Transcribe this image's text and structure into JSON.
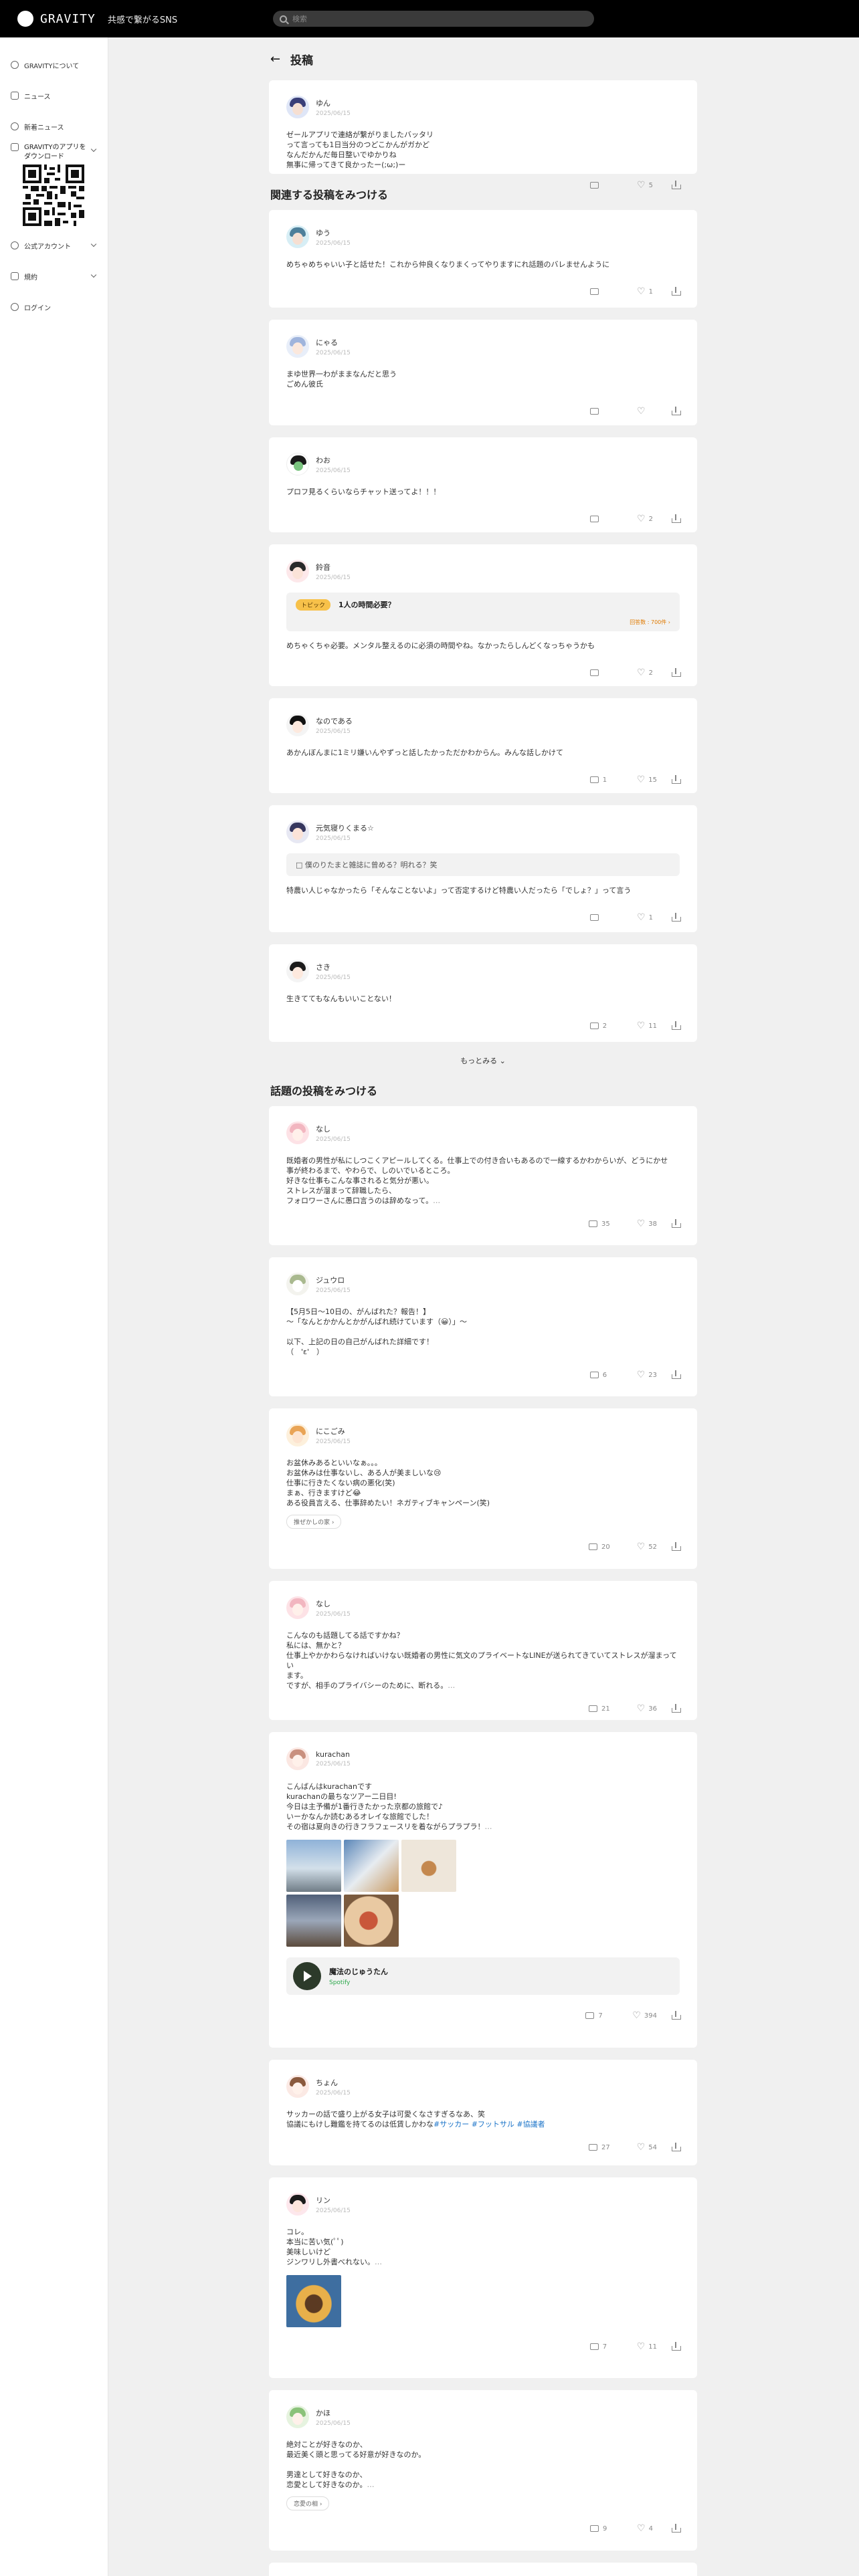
{
  "header": {
    "logo_word": "GRAVITY",
    "tagline": "共感で繋がるSNS",
    "search_placeholder": "検索"
  },
  "sidebar": {
    "items": [
      {
        "label": "GRAVITYについて"
      },
      {
        "label": "ニュース"
      },
      {
        "label": "新着ニュース"
      }
    ],
    "app_label": "GRAVITYのアプリをダウンロード",
    "items2": [
      {
        "label": "公式アカウント"
      },
      {
        "label": "規約"
      },
      {
        "label": "ログイン"
      }
    ]
  },
  "main": {
    "page_title": "投稿",
    "section_related": "関連する投稿をみつける",
    "more_label": "もっとみる ⌄",
    "section_trending": "話題の投稿をみつける"
  },
  "hero_post": {
    "name": "ゆん",
    "date": "2025/06/15",
    "body": "ゼールアプリで連絡が繋がりましたバッタリ\nって言っても1日当分のつどこかんがガかど\nなんだかんだ毎日整いでゆかりね\n無事に帰ってきて良かったー(;ω;)ー",
    "comments": "",
    "likes": "5"
  },
  "related": [
    {
      "name": "ゆう",
      "date": "2025/06/15",
      "body": "めちゃめちゃいい子と話せた！これから仲良くなりまくってやりますにれ話題のバレませんように",
      "comments": "",
      "likes": "1"
    },
    {
      "name": "にゃる",
      "date": "2025/06/15",
      "body": "まゆ世界一わがままなんだと思う\nごめん彼氏",
      "comments": "",
      "likes": ""
    },
    {
      "name": "わお",
      "date": "2025/06/15",
      "body": "プロフ見るくらいならチャット送ってよ！！！",
      "comments": "",
      "likes": "2"
    },
    {
      "name": "鈴音",
      "date": "2025/06/15",
      "topic_badge": "トピック",
      "topic_title": "1人の時間必要？",
      "topic_foot": "回答数 : 700件 ›",
      "body": "めちゃくちゃ必要。メンタル整えるのに必須の時間やね。なかったらしんどくなっちゃうかも",
      "comments": "",
      "likes": "2"
    },
    {
      "name": "なのである",
      "date": "2025/06/15",
      "body": "あかんぼんまに1ミリ嫌いんやずっと話したかっただかわからん。みんな話しかけて",
      "comments": "1",
      "likes": "15"
    },
    {
      "name": "元気寝りくまる☆",
      "date": "2025/06/15",
      "quote": "僕のりたまと雑誌に曾める？明れる？笑",
      "body": "特農い人じゃなかったら「そんなことないよ」って否定するけど特農い人だったら「でしょ？」って言う",
      "comments": "",
      "likes": "1"
    },
    {
      "name": "さき",
      "date": "2025/06/15",
      "body": "生きててもなんもいいことない！",
      "comments": "2",
      "likes": "11"
    }
  ],
  "trending": [
    {
      "name": "なし",
      "date": "2025/06/15",
      "body": "既婚者の男性が私にしつこくアピールしてくる。仕事上での付き合いもあるので一線するかわからいが、どうにかせ\n事が終わるまで、やわらで、しのいでいるところ。\n好きな仕事もこんな事されると気分が悪い。\nストレスが溜まって辞職したら、\nフォロワーさんに愚口言うのは辞めなって。",
      "more": "…",
      "comments": "35",
      "likes": "38"
    },
    {
      "name": "ジュウロ",
      "date": "2025/06/15",
      "body": "【5月5日〜10日の、がんばれた？報告！】\n〜「なんとかかんとかがんばれ続けています（😀）」〜\n\n以下、上記の日の自己がんばれた詳細です！\n（　'ε'　）",
      "more": "",
      "comments": "6",
      "likes": "23"
    },
    {
      "name": "にこごみ",
      "date": "2025/06/15",
      "body": "お盆休みあるといいなぁ。。。\nお盆休みは仕事ないし、ある人が美ましいな😢\n仕事に行きたくない病の悪化(笑)\nまぁ、行きますけど😂\nある役員言える、仕事辞めたい！ネガティブキャンペーン(笑)",
      "chip": "推ぜかしの家 ›",
      "comments": "20",
      "likes": "52"
    },
    {
      "name": "なし",
      "date": "2025/06/15",
      "body": "こんなのも話題してる話ですかね？\n私には、無かと？\n仕事上やかかわらなければいけない既婚者の男性に気文のプライベートなLINEが送られてきていてストレスが溜まってい\nます。\nですが、相手のプライバシーのために、断れる。",
      "more": "…",
      "comments": "21",
      "likes": "36"
    },
    {
      "name": "kurachan",
      "date": "2025/06/15",
      "body": "こんばんはkurachanです\nkurachanの最ちなツアー二日目!\n今日は主予備が1番行きたかった京都の旅館で♪\nいーかなんか読むあるオレイな旅館でした！\nその宿は夏向きの行きフラフェースリを着ながらプラプラ！",
      "more": "…",
      "music_title": "魔法のじゅうたん",
      "music_sub": "Spotify",
      "comments": "7",
      "likes": "394"
    },
    {
      "name": "ちょん",
      "date": "2025/06/15",
      "body": "サッカーの話で盛り上がる女子は可愛くなさすぎるなあ、笑\n協議にもけし難鑑を持てるのは低賃しかわな",
      "tags": "#サッカー #フットサル #協議者",
      "comments": "27",
      "likes": "54"
    },
    {
      "name": "リン",
      "date": "2025/06/15",
      "body": "コレ。\n本当に苦い気(ﾟﾟ)\n美味しいけど\nジンワリし外書べれない。",
      "more": "…",
      "comments": "7",
      "likes": "11"
    },
    {
      "name": "かほ",
      "date": "2025/06/15",
      "body": "絶対ことが好きなのか、\n最近美く頭と思ってる好意が好きなのか。\n\n男達として好きなのか、\n恋愛として好きなのか。",
      "more": "…",
      "chip": "恋愛の相 ›",
      "comments": "9",
      "likes": "4"
    }
  ],
  "colors": {
    "topbar": "#000000",
    "background": "#f0f0f0",
    "card": "#ffffff",
    "tag": "#1a73c8",
    "topic_badge": "#f7c14a"
  },
  "icons": [
    "search-icon",
    "back-arrow-icon",
    "comment-icon",
    "heart-icon",
    "share-icon",
    "qr-code-icon"
  ]
}
